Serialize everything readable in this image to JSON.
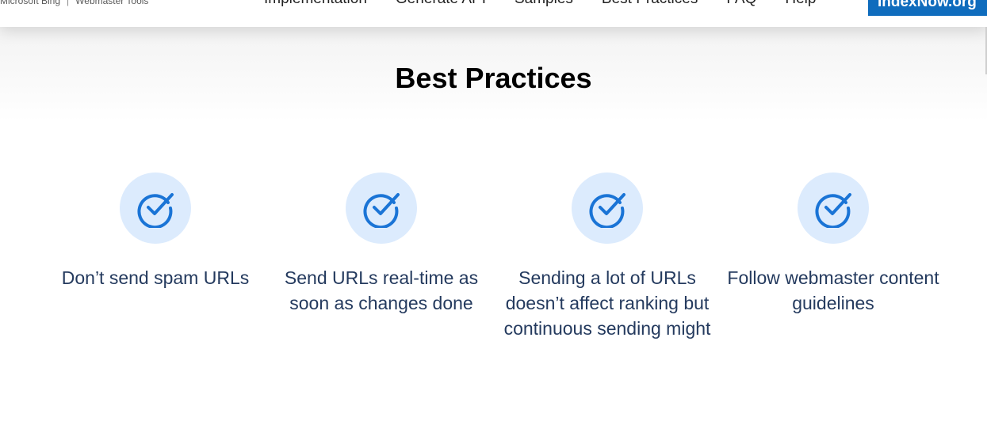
{
  "header": {
    "brand_left": "Microsoft Bing",
    "brand_separator": "|",
    "brand_right": "Webmaster Tools",
    "nav": [
      "Implementation",
      "Generate API",
      "Samples",
      "Best Practices",
      "FAQ",
      "Help"
    ],
    "cta_label": "IndexNow.org"
  },
  "section": {
    "title": "Best Practices"
  },
  "cards": [
    {
      "icon": "check-circle-icon",
      "text": "Don’t send spam URLs"
    },
    {
      "icon": "check-circle-icon",
      "text": "Send URLs real-time as soon as changes done"
    },
    {
      "icon": "check-circle-icon",
      "text": "Sending a lot of URLs doesn’t affect ranking but continuous sending might"
    },
    {
      "icon": "check-circle-icon",
      "text": "Follow webmaster content guidelines"
    }
  ],
  "colors": {
    "accent": "#0f6cbd",
    "icon_bg": "#dcebfd",
    "icon_stroke": "#1a74d6",
    "card_text": "#243a5e"
  }
}
